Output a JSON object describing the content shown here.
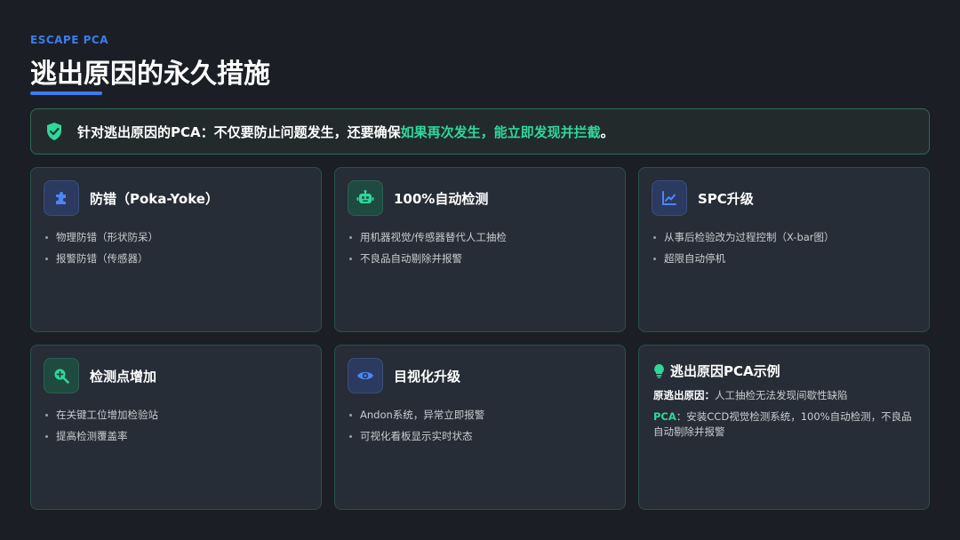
{
  "header": {
    "eyebrow": "ESCAPE PCA",
    "title": "逃出原因的永久措施"
  },
  "banner": {
    "text_main": "针对逃出原因的PCA：不仅要防止问题发生，还要确保",
    "text_highlight": "如果再次发生，能立即发现并拦截",
    "text_end": "。",
    "icon": "shield-check-icon"
  },
  "cards": [
    {
      "title": "防错（Poka-Yoke）",
      "icon": "puzzle-icon",
      "bullets": [
        "物理防错（形状防呆）",
        "报警防错（传感器）"
      ]
    },
    {
      "title": "100%自动检测",
      "icon": "robot-icon",
      "bullets": [
        "用机器视觉/传感器替代人工抽检",
        "不良品自动剔除并报警"
      ]
    },
    {
      "title": "SPC升级",
      "icon": "line-chart-icon",
      "bullets": [
        "从事后检验改为过程控制（X-bar图）",
        "超限自动停机"
      ]
    },
    {
      "title": "检测点增加",
      "icon": "search-plus-icon",
      "bullets": [
        "在关键工位增加检验站",
        "提高检测覆盖率"
      ]
    },
    {
      "title": "目视化升级",
      "icon": "eye-icon",
      "bullets": [
        "Andon系统，异常立即报警",
        "可视化看板显示实时状态"
      ]
    }
  ],
  "example": {
    "title": "逃出原因PCA示例",
    "icon": "lightbulb-icon",
    "line1_label": "原逃出原因",
    "line1_sep": "：",
    "line1_text": "人工抽检无法发现间歇性缺陷",
    "line2_label": "PCA",
    "line2_sep": "：",
    "line2_text": "安装CCD视觉检测系统，100%自动检测，不良品自动剔除并报警"
  },
  "colors": {
    "background": "#1b1f25",
    "accent_blue": "#3b7cf0",
    "accent_green": "#2ed89a",
    "card_bg": "#272d36",
    "card_border": "#24524a"
  }
}
